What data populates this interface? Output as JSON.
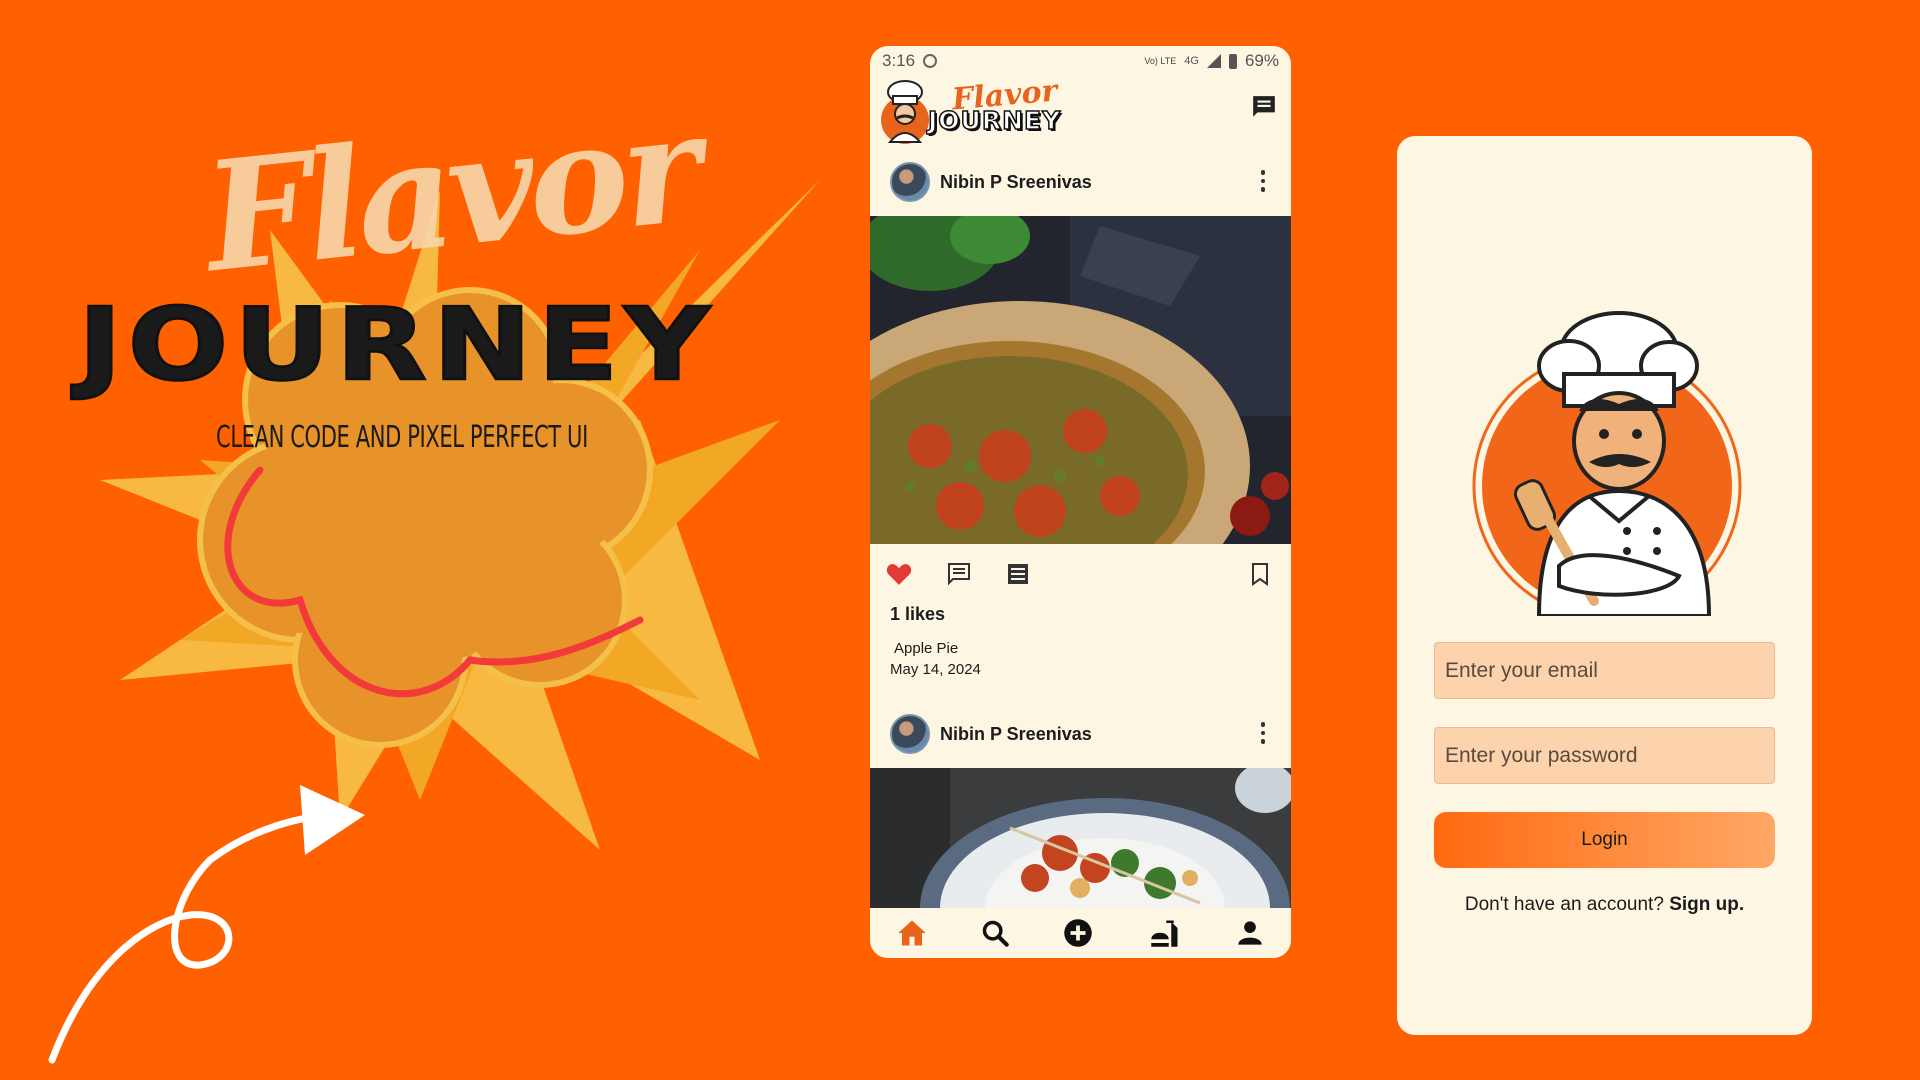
{
  "promo": {
    "title_top": "Flavor",
    "title_bottom": "JOURNEY",
    "tagline": "CLEAN CODE AND PIXEL PERFECT UI"
  },
  "feed_phone": {
    "status": {
      "time": "3:16",
      "network_small": "Vo) LTE",
      "network": "4G",
      "battery": "69%"
    },
    "app_logo": {
      "top": "Flavor",
      "bottom": "JOURNEY"
    },
    "icons": {
      "chat": "chat-icon",
      "like": "heart-icon",
      "comment": "comment-icon",
      "details": "list-icon",
      "save": "bookmark-icon"
    },
    "posts": [
      {
        "username": "Nibin P Sreenivas",
        "likes": "1 likes",
        "caption": "Apple Pie",
        "date": "May 14, 2024"
      },
      {
        "username": "Nibin P Sreenivas"
      }
    ],
    "bottom_nav": [
      "home-icon",
      "search-icon",
      "add-icon",
      "recipes-icon",
      "profile-icon"
    ]
  },
  "login_phone": {
    "email_placeholder": "Enter your email",
    "password_placeholder": "Enter your password",
    "login_label": "Login",
    "signup_prompt": "Don't have an account?",
    "signup_link": "Sign up."
  },
  "colors": {
    "background": "#ff6000",
    "accent": "#e8631c",
    "cream": "#fdf6e3",
    "field": "#fdd3ae",
    "like": "#e53935"
  }
}
